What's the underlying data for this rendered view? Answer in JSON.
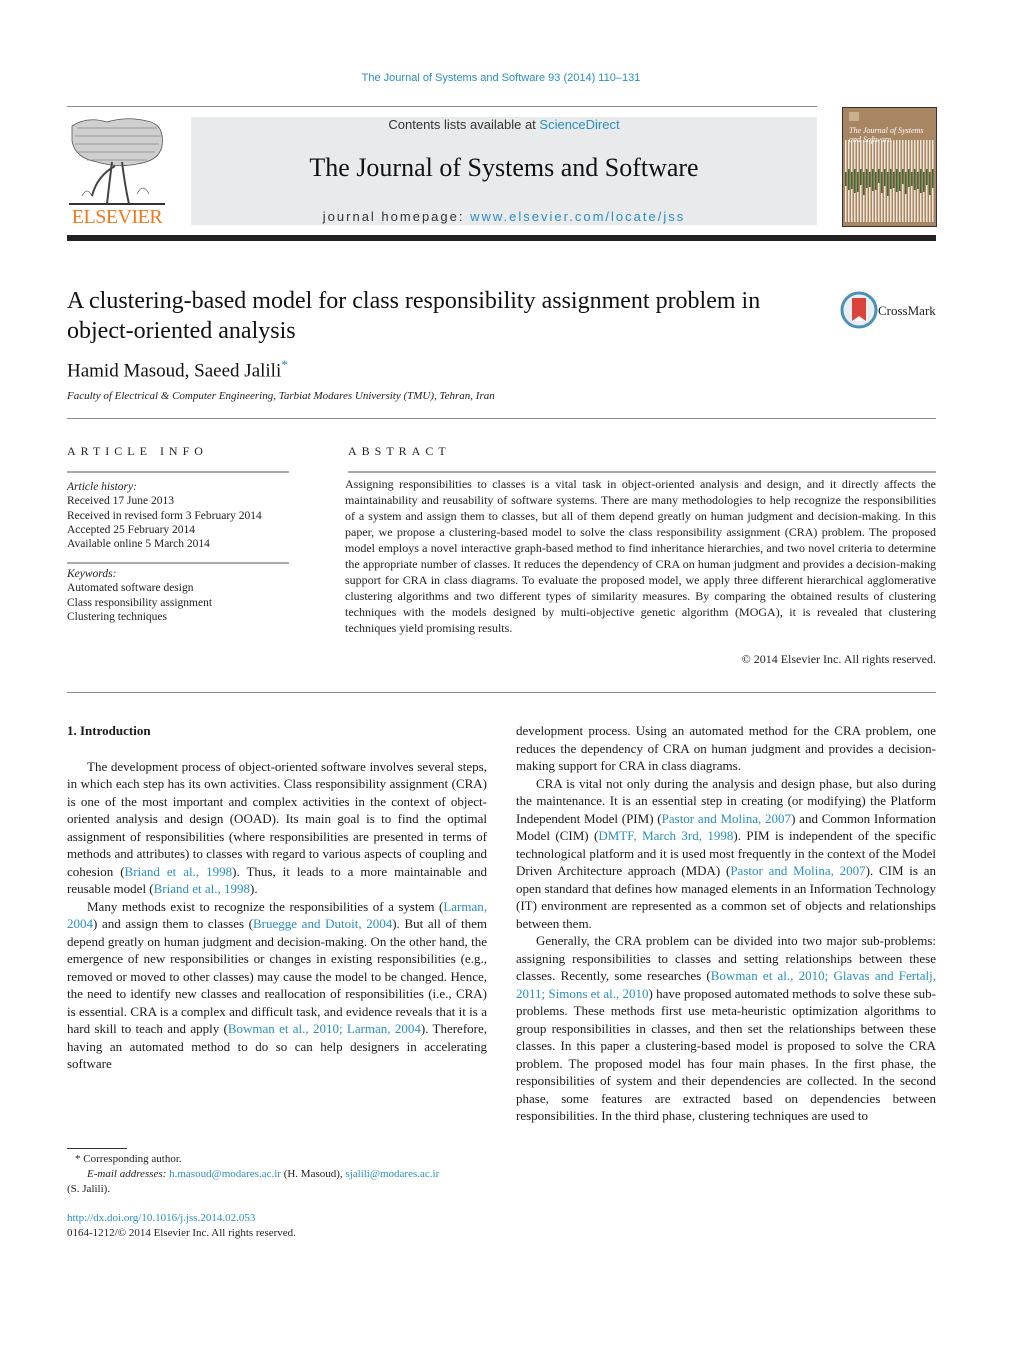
{
  "header": {
    "citation": "The Journal of Systems and Software 93 (2014) 110–131",
    "contents_prefix": "Contents lists available at ",
    "contents_link": "ScienceDirect",
    "journal_title": "The Journal of Systems and Software",
    "homepage_prefix": "journal homepage: ",
    "homepage_link": "www.elsevier.com/locate/jss",
    "publisher_logo": "ELSEVIER",
    "cover_title": "The Journal of Systems and Software",
    "colors": {
      "link": "#2a8fc0",
      "elsevier_orange": "#f07a1c",
      "cover_brown": "#a88563",
      "cover_green": "#3f6b3a",
      "crossmark_red": "#d9453a"
    }
  },
  "article": {
    "title": "A clustering-based model for class responsibility assignment problem in object-oriented analysis",
    "crossmark_label": "CrossMark",
    "authors": "Hamid Masoud, Saeed Jalili",
    "author_mark": "*",
    "affiliation": "Faculty of Electrical & Computer Engineering, Tarbiat Modares University (TMU), Tehran, Iran"
  },
  "article_info": {
    "heading": "ARTICLE INFO",
    "history_label": "Article history:",
    "history": [
      "Received 17 June 2013",
      "Received in revised form 3 February 2014",
      "Accepted 25 February 2014",
      "Available online 5 March 2014"
    ],
    "keywords_label": "Keywords:",
    "keywords": [
      "Automated software design",
      "Class responsibility assignment",
      "Clustering techniques"
    ]
  },
  "abstract": {
    "heading": "ABSTRACT",
    "text": "Assigning responsibilities to classes is a vital task in object-oriented analysis and design, and it directly affects the maintainability and reusability of software systems. There are many methodologies to help recognize the responsibilities of a system and assign them to classes, but all of them depend greatly on human judgment and decision-making. In this paper, we propose a clustering-based model to solve the class responsibility assignment (CRA) problem. The proposed model employs a novel interactive graph-based method to find inheritance hierarchies, and two novel criteria to determine the appropriate number of classes. It reduces the dependency of CRA on human judgment and provides a decision-making support for CRA in class diagrams. To evaluate the proposed model, we apply three different hierarchical agglomerative clustering algorithms and two different types of similarity measures. By comparing the obtained results of clustering techniques with the models designed by multi-objective genetic algorithm (MOGA), it is revealed that clustering techniques yield promising results.",
    "copyright": "© 2014 Elsevier Inc. All rights reserved."
  },
  "body": {
    "section_title": "1.  Introduction",
    "p1": {
      "a": "The development process of object-oriented software involves several steps, in which each step has its own activities. Class responsibility assignment (CRA) is one of the most important and complex activities in the context of object-oriented analysis and design (OOAD). Its main goal is to find the optimal assignment of responsibilities (where responsibilities are presented in terms of methods and attributes) to classes with regard to various aspects of coupling and cohesion (",
      "ref1": "Briand et al., 1998",
      "b": "). Thus, it leads to a more maintainable and reusable model (",
      "ref2": "Briand et al., 1998",
      "c": ")."
    },
    "p2": {
      "a": "Many methods exist to recognize the responsibilities of a system (",
      "ref1": "Larman, 2004",
      "b": ") and assign them to classes (",
      "ref2": "Bruegge and Dutoit, 2004",
      "c": "). But all of them depend greatly on human judgment and decision-making. On the other hand, the emergence of new responsibilities or changes in existing responsibilities (e.g., removed or moved to other classes) may cause the model to be changed. Hence, the need to identify new classes and reallocation of responsibilities (i.e., CRA) is essential. CRA is a complex and difficult task, and evidence reveals that it is a hard skill to teach and apply (",
      "ref3": "Bowman et al., 2010; Larman, 2004",
      "d": "). Therefore, having an automated method to do so can help designers in accelerating software development process. Using an automated method for the CRA problem, one reduces the dependency of CRA on human judgment and provides a decision-making support for CRA in class diagrams."
    },
    "p3": {
      "a": "CRA is vital not only during the analysis and design phase, but also during the maintenance. It is an essential step in creating (or modifying) the Platform Independent Model (PIM) (",
      "ref1": "Pastor and Molina, 2007",
      "b": ") and Common Information Model (CIM) (",
      "ref2": "DMTF, March 3rd, 1998",
      "c": "). PIM is independent of the specific technological platform and it is used most frequently in the context of the Model Driven Architecture approach (MDA) (",
      "ref3": "Pastor and Molina, 2007",
      "d": "). CIM is an open standard that defines how managed elements in an Information Technology (IT) environment are represented as a common set of objects and relationships between them."
    },
    "p4": {
      "a": "Generally, the CRA problem can be divided into two major sub-problems: assigning responsibilities to classes and setting relationships between these classes. Recently, some researches (",
      "ref1": "Bowman et al., 2010; Glavas and Fertalj, 2011; Simons et al., 2010",
      "b": ") have proposed automated methods to solve these sub-problems. These methods first use meta-heuristic optimization algorithms to group responsibilities in classes, and then set the relationships between these classes. In this paper a clustering-based model is proposed to solve the CRA problem. The proposed model has four main phases. In the first phase, the responsibilities of system and their dependencies are collected. In the second phase, some features are extracted based on dependencies between responsibilities. In the third phase, clustering techniques are used to"
    }
  },
  "footnotes": {
    "corresponding": "* Corresponding author.",
    "email_label": "E-mail addresses: ",
    "email1": "h.masoud@modares.ac.ir",
    "email1_name": " (H. Masoud), ",
    "email2": "sjalili@modares.ac.ir",
    "email2_name": "(S. Jalili).",
    "doi": "http://dx.doi.org/10.1016/j.jss.2014.02.053",
    "issn_line": "0164-1212/© 2014 Elsevier Inc. All rights reserved."
  }
}
